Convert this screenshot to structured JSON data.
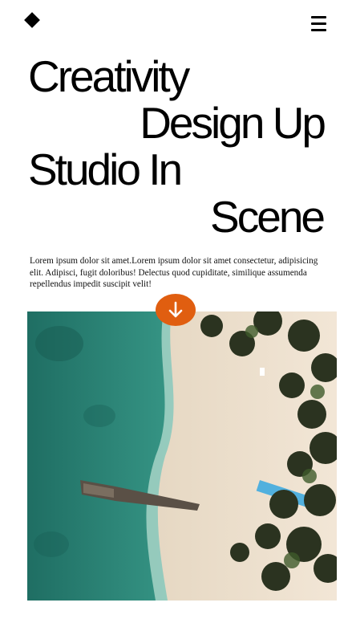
{
  "header": {
    "logo_icon": "diamond-icon",
    "menu_icon": "hamburger-menu-icon"
  },
  "headline": {
    "line1": "Creativity",
    "line2": "Design Up",
    "line3": "Studio In",
    "line4": "Scene"
  },
  "intro": {
    "text": "Lorem ipsum dolor sit amet.Lorem ipsum dolor sit amet consectetur, adipisicing elit. Adipisci, fugit doloribus! Delectus quod cupiditate, similique assumenda repellendus impedit suscipit velit!"
  },
  "scroll_button": {
    "icon": "arrow-down-icon",
    "color": "#e05e10"
  },
  "hero": {
    "subject": "aerial-beach-photo"
  }
}
